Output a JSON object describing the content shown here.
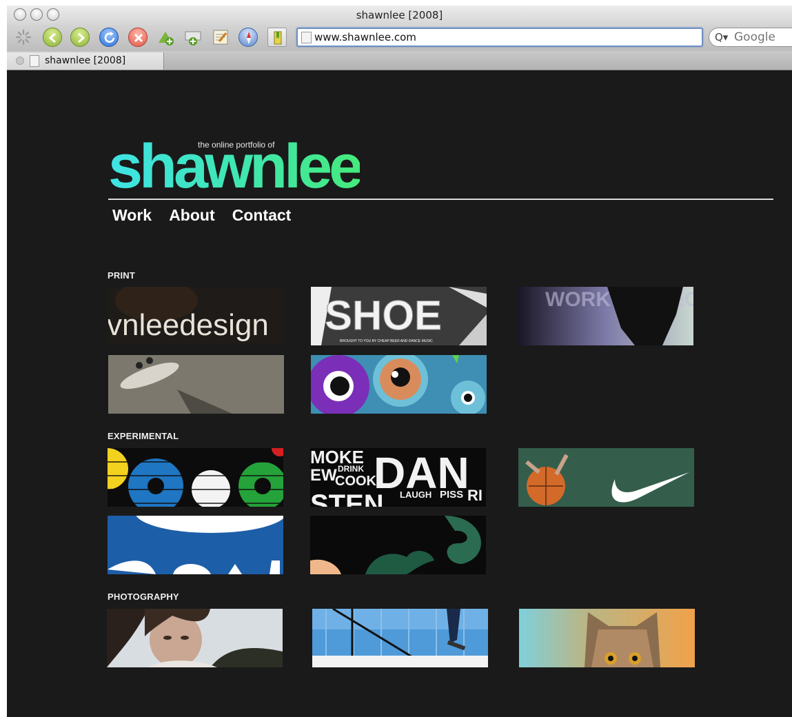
{
  "window": {
    "title": "shawnlee [2008]"
  },
  "toolbar": {
    "url": "www.shawnlee.com",
    "search_placeholder": "Google",
    "search_glyph": "Q▾"
  },
  "tabs": [
    {
      "label": "shawnlee [2008]"
    }
  ],
  "site": {
    "tagline": "the online portfolio of",
    "logo": "shawnlee",
    "nav": [
      "Work",
      "About",
      "Contact"
    ]
  },
  "sections": {
    "print": "PRINT",
    "experimental": "EXPERIMENTAL",
    "photography": "PHOTOGRAPHY"
  },
  "thumb_text": {
    "design": "vnleedesign",
    "shoe": "SHOE",
    "shoe_sub": "BROUGHT TO YOU BY CHEAP BEER AND DANCE MUSIC",
    "words": "WORK IT CHECK",
    "dance_big": "DAN",
    "moke": "MOKE",
    "drink": "DRINK",
    "cook": "COOK",
    "ew": "EW",
    "laugh": "LAUGH",
    "piss": "PISS",
    "sten": "STEN",
    "rl": "RI"
  },
  "colors": {
    "page_bg": "#1a1a1a",
    "logo_start": "#3fe3e6",
    "logo_end": "#45ea7c"
  }
}
